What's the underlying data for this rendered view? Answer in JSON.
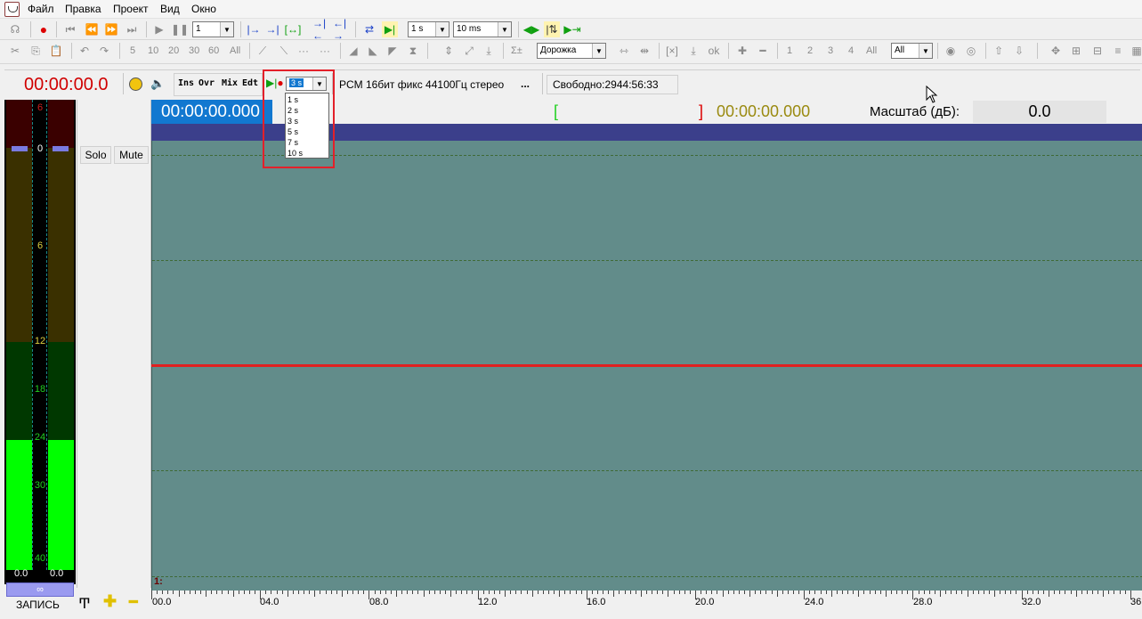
{
  "menu": {
    "items": [
      "Файл",
      "Правка",
      "Проект",
      "Вид",
      "Окно"
    ]
  },
  "toolbar1": {
    "zoom_combo": "1",
    "snap_combo": "1 s",
    "step_combo": "10 ms"
  },
  "toolbar2": {
    "numbers": [
      "5",
      "10",
      "20",
      "30",
      "60",
      "All"
    ],
    "track_mode": "Дорожка",
    "sigma": "Σ±",
    "channels": [
      "1",
      "2",
      "3",
      "4",
      "All"
    ],
    "channel_combo": "All"
  },
  "status": {
    "time": "00:00:00.0",
    "mode_ins": "Ins",
    "mode_ovr": "Ovr",
    "mode_mix": "Mix",
    "mode_edt": "Edt",
    "preroll_value": "3 s",
    "format": "PCM 16бит фикс 44100Гц стерео",
    "format_more": "...",
    "free_space": "Свободно:2944:56:33"
  },
  "dropdown": {
    "options": [
      "1 s",
      "2 s",
      "3 s",
      "5 s",
      "7 s",
      "10 s"
    ],
    "selected": "3 s"
  },
  "timebar": {
    "cursor_time": "00:00:00.000",
    "sel_start_bracket": "[",
    "sel_end_bracket": "]",
    "sel_time": "00:00:00.000",
    "scale_label": "Масштаб (дБ):",
    "scale_value": "0.0"
  },
  "vu": {
    "ticks": [
      "6",
      "0",
      "6",
      "12",
      "18",
      "24",
      "30",
      "40"
    ],
    "left_level": "0.0",
    "right_level": "0.0",
    "record_label": "ЗАПИСЬ"
  },
  "track": {
    "solo": "Solo",
    "mute": "Mute",
    "number": "1:"
  },
  "ruler": {
    "labels": [
      "00.0",
      "04.0",
      "08.0",
      "12.0",
      "16.0",
      "20.0",
      "24.0",
      "28.0",
      "32.0",
      "36"
    ]
  },
  "colors": {
    "wave_bg": "#628c8a",
    "blue_bar": "#3b3f8b",
    "cursor_line": "#e02020",
    "time_red": "#d00000",
    "time_olive": "#9a8a10"
  }
}
